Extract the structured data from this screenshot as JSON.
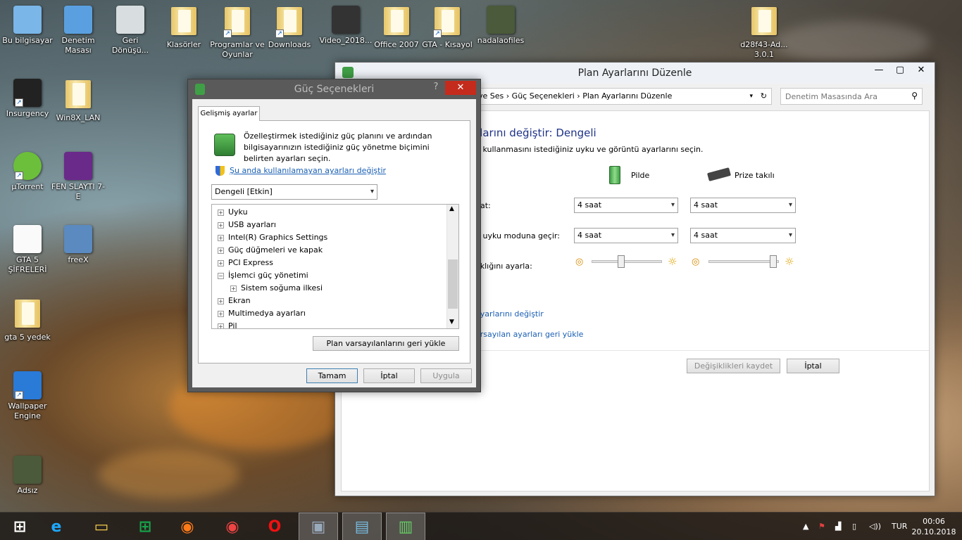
{
  "desktop": {
    "icons": [
      {
        "label": "Bu bilgisayar",
        "icon": "computer-icon"
      },
      {
        "label": "Denetim Masası",
        "icon": "control-panel-icon"
      },
      {
        "label": "Geri Dönüşü...",
        "icon": "recycle-bin-icon"
      },
      {
        "label": "Klasörler",
        "icon": "folder-icon"
      },
      {
        "label": "Programlar ve Oyunlar",
        "icon": "folder-icon"
      },
      {
        "label": "Downloads",
        "icon": "folder-icon"
      },
      {
        "label": "Video_2018...",
        "icon": "video-icon"
      },
      {
        "label": "Office 2007",
        "icon": "folder-icon"
      },
      {
        "label": "GTA - Kısayol",
        "icon": "folder-icon"
      },
      {
        "label": "nadalaofiles",
        "icon": "image-icon"
      },
      {
        "label": "d28f43-Ad... 3.0.1",
        "icon": "folder-icon"
      },
      {
        "label": "Insurgency",
        "icon": "insurgency-icon"
      },
      {
        "label": "Win8X_LAN",
        "icon": "folder-icon"
      },
      {
        "label": "µTorrent",
        "icon": "utorrent-icon"
      },
      {
        "label": "FEN SLAYTI 7-E",
        "icon": "presentation-icon"
      },
      {
        "label": "GTA 5 ŞİFRELERİ",
        "icon": "text-file-icon"
      },
      {
        "label": "freeX",
        "icon": "installer-icon"
      },
      {
        "label": "gta 5 yedek",
        "icon": "folder-icon"
      },
      {
        "label": "Wallpaper Engine",
        "icon": "wallpaper-engine-icon"
      },
      {
        "label": "Adsız",
        "icon": "image-icon"
      }
    ]
  },
  "plan_window": {
    "title": "Plan Ayarlarını Düzenle",
    "breadcrumb": {
      "part1": "ve Ses",
      "part2": "Güç Seçenekleri",
      "part3": "Plan Ayarlarını Düzenle"
    },
    "search_placeholder": "Denetim Masasında Ara",
    "heading": "rlarını değiştir: Dengeli",
    "subheading": "n kullanmasını istediğiniz uyku ve görüntü ayarlarını seçin.",
    "col_battery": "Pilde",
    "col_plugged": "Prize takılı",
    "row1_label": "pat:",
    "row2_label": "n uyku moduna geçir:",
    "row3_label": "aklığını ayarla:",
    "row1_battery": "4 saat",
    "row1_plugged": "4 saat",
    "row2_battery": "4 saat",
    "row2_plugged": "4 saat",
    "brightness_battery": 0.4,
    "brightness_plugged": 0.95,
    "link_advanced": "ayarlarını değiştir",
    "link_restore": "arsayılan ayarları geri yükle",
    "save_label": "Değişiklikleri kaydet",
    "cancel_label": "İptal"
  },
  "power_dialog": {
    "title": "Güç Seçenekleri",
    "help": "?",
    "tab": "Gelişmiş ayarlar",
    "description": "Özelleştirmek istediğiniz güç planını ve ardından bilgisayarınızın istediğiniz güç yönetme biçimini belirten ayarları seçin.",
    "change_link": "Şu anda kullanılamayan ayarları değiştir",
    "plan_select": "Dengeli [Etkin]",
    "tree": [
      {
        "label": "Uyku",
        "sign": "+",
        "indent": 0
      },
      {
        "label": "USB ayarları",
        "sign": "+",
        "indent": 0
      },
      {
        "label": "Intel(R) Graphics Settings",
        "sign": "+",
        "indent": 0
      },
      {
        "label": "Güç düğmeleri ve kapak",
        "sign": "+",
        "indent": 0
      },
      {
        "label": "PCI Express",
        "sign": "+",
        "indent": 0
      },
      {
        "label": "İşlemci güç yönetimi",
        "sign": "−",
        "indent": 0
      },
      {
        "label": "Sistem soğuma ilkesi",
        "sign": "+",
        "indent": 1
      },
      {
        "label": "Ekran",
        "sign": "+",
        "indent": 0
      },
      {
        "label": "Multimedya ayarları",
        "sign": "+",
        "indent": 0
      },
      {
        "label": "Pil",
        "sign": "+",
        "indent": 0
      }
    ],
    "restore_label": "Plan varsayılanlarını geri yükle",
    "ok_label": "Tamam",
    "cancel_label": "İptal",
    "apply_label": "Uygula"
  },
  "taskbar": {
    "apps": [
      {
        "name": "start-button",
        "glyph": "⊞"
      },
      {
        "name": "internet-explorer",
        "glyph": "e"
      },
      {
        "name": "file-explorer",
        "glyph": "▭"
      },
      {
        "name": "store",
        "glyph": "⊞"
      },
      {
        "name": "firefox",
        "glyph": "◉"
      },
      {
        "name": "chrome",
        "glyph": "◉"
      },
      {
        "name": "opera",
        "glyph": "O"
      },
      {
        "name": "monitor-app",
        "glyph": "▣"
      },
      {
        "name": "control-panel",
        "glyph": "▤"
      },
      {
        "name": "power-options",
        "glyph": "▥"
      }
    ],
    "language": "TUR",
    "time": "00:06",
    "date": "20.10.2018"
  }
}
